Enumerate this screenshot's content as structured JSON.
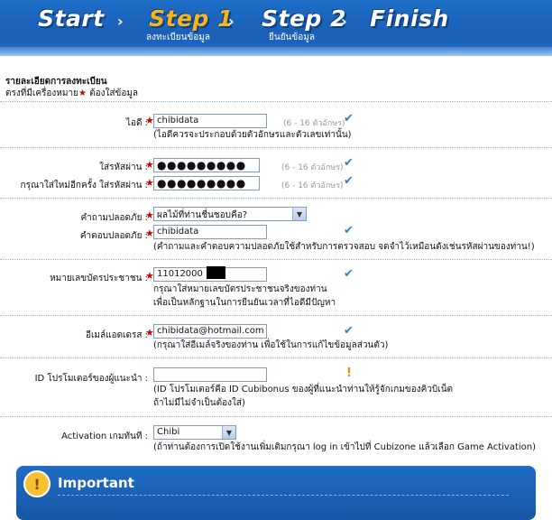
{
  "steps": [
    {
      "label": "Start",
      "sub": ""
    },
    {
      "label": "Step 1",
      "sub": "ลงทะเบียนข้อมูล"
    },
    {
      "label": "Step 2",
      "sub": "ยืนยันข้อมูล"
    },
    {
      "label": "Finish",
      "sub": ""
    }
  ],
  "arrow_glyph": "›",
  "form": {
    "title": "รายละเอียดการลงทะเบียน",
    "note_prefix": "ตรงที่มีเครื่องหมาย",
    "note_star": "★",
    "note_suffix": " ต้องใส่ข้อมูล",
    "required_mark": "★",
    "id": {
      "label": "ไอดี :",
      "value": "chibidata",
      "hint": "(6 - 16 ตัวอักษร)",
      "desc": "(ไอดีควรจะประกอบด้วยตัวอักษรและตัวเลขเท่านั้น)"
    },
    "password": {
      "label": "ใส่รหัสผ่าน :",
      "value": "●●●●●●●●●",
      "hint": "(6 - 16 ตัวอักษร)"
    },
    "password_confirm": {
      "label": "กรุณาใส่ใหม่อีกครั้ง ใส่รหัสผ่าน :",
      "value": "●●●●●●●●●",
      "hint": "(6 - 16 ตัวอักษร)"
    },
    "security_question": {
      "label": "คำถามปลอดภัย :",
      "value": "ผลไม้ที่ท่านชื่นชอบคือ?"
    },
    "security_answer": {
      "label": "คำตอบปลอดภัย :",
      "value": "chibidata",
      "desc": "(คำถามและคำตอบความปลอดภัยใช้สำหรับการตรวจสอบ จดจำไว้เหมือนดังเช่นรหัสผ่านของท่าน!)"
    },
    "citizen_id": {
      "label": "หมายเลขบัตรประชาชน :",
      "value": "11012000",
      "desc_line1": "กรุณาใส่หมายเลขบัตรประชาชนจริงของท่าน",
      "desc_line2": "เพื่อเป็นหลักฐานในการยืนยันเวลาที่ไอดีมีปัญหา"
    },
    "email": {
      "label": "อีเมล์แอดเดรส :",
      "value": "chibidata@hotmail.com",
      "desc": "(กรุณาใส่อีเมล์จริงของท่าน เพื่อใช้ในการแก้ไขข้อมูลส่วนตัว)"
    },
    "promoter_id": {
      "label": "ID โปรโมเตอร์ของผู้แนะนำ :",
      "value": "",
      "desc_line1": "(ID โปรโมเตอร์คือ ID Cubibonus ของผู้ที่แนะนำท่านให้รู้จักเกมของคิวบิเน็ต",
      "desc_line2": "ถ้าไม่มีไม่จำเป็นต้องใส่)"
    },
    "activation": {
      "label": "Activation เกมทันที :",
      "value": "Chibi",
      "desc": "(ถ้าท่านต้องการเปิดใช้งานเพิ่มเติมกรุณา log in เข้าไปที่ Cubizone แล้วเลือก Game Activation)"
    }
  },
  "icons": {
    "check": "✔",
    "warning": "!",
    "chevron": "▼",
    "important": "!"
  },
  "important": {
    "title": "Important"
  },
  "colors": {
    "header_blue": "#1a60b8",
    "active_step": "#f4b520",
    "required": "#d00000",
    "check": "#2f7cd6",
    "warning": "#f08a00"
  }
}
